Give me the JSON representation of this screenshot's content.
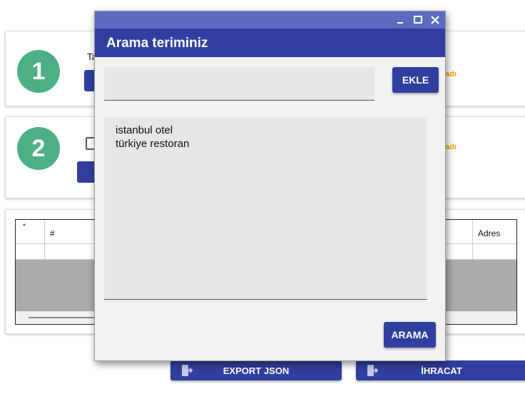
{
  "background": {
    "card1": {
      "step": "1",
      "label": "Ta",
      "orange_text": "adı"
    },
    "card2": {
      "step": "2",
      "orange_text": "adı"
    },
    "grid": {
      "columns": [
        "#",
        "Adres"
      ],
      "new_row_marker": "*"
    },
    "buttons": {
      "export_json": "EXPORT JSON",
      "ihracat": "İHRACAT"
    }
  },
  "dialog": {
    "title": "Arama teriminiz",
    "window_controls": {
      "minimize": "‗",
      "maximize": "☐",
      "close": "✕"
    },
    "input": {
      "value": "",
      "placeholder": ""
    },
    "add_button": "EKLE",
    "terms": [
      "istanbul otel",
      "türkiye restoran"
    ],
    "search_button": "ARAMA"
  },
  "colors": {
    "primary": "#303f9f",
    "titlebar": "#5c6bc0",
    "step_circle": "#4caf85",
    "accent_orange": "#f0a000"
  }
}
